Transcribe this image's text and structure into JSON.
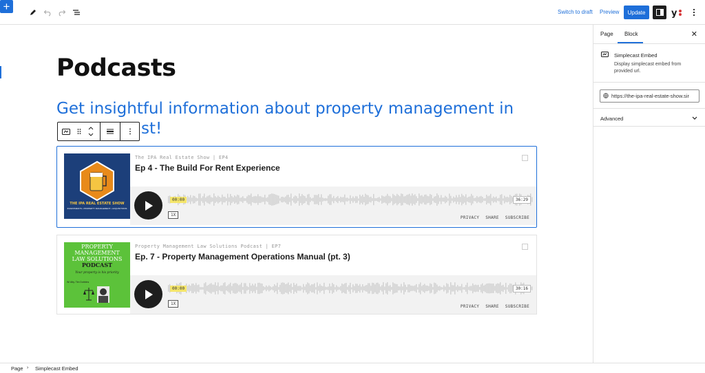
{
  "toolbar": {
    "switch_to_draft": "Switch to draft",
    "preview": "Preview",
    "update": "Update"
  },
  "content": {
    "title": "Podcasts",
    "subtitle": "Get insightful information about property management in",
    "subtitle_tail": "st!"
  },
  "embeds": [
    {
      "show_line": "The IPA Real Estate Show | EP4",
      "title": "Ep 4 - The Build For Rent Experience",
      "cover_text_top": "THE IPA REAL ESTATE SHOW",
      "cover_text_bottom": "INVESTMENTS • PROPERTY MANAGEMENT • ACQUISITIONS",
      "time_start": "00:00",
      "time_end": "36:29",
      "speed": "1X",
      "links": [
        "PRIVACY",
        "SHARE",
        "SUBSCRIBE"
      ]
    },
    {
      "show_line": "Property Management Law Solutions Podcast | EP7",
      "title": "Ep. 7 - Property Management Operations Manual (pt. 3)",
      "cover_lines": [
        "PROPERTY",
        "MANAGEMENT",
        "LAW SOLUTIONS",
        "PODCAST"
      ],
      "cover_tagline": "Your property is his priority",
      "cover_host": "W/ Atty. Tim Dobbins",
      "time_start": "00:00",
      "time_end": "30:16",
      "speed": "1X",
      "links": [
        "PRIVACY",
        "SHARE",
        "SUBSCRIBE"
      ]
    }
  ],
  "sidebar": {
    "tab_page": "Page",
    "tab_block": "Block",
    "block_name": "Simplecast Embed",
    "block_desc": "Display simplecast embed from provided url.",
    "url_value": "https://the-ipa-real-estate-show.sir",
    "advanced": "Advanced"
  },
  "statusbar": {
    "crumb_page": "Page",
    "crumb_block": "Simplecast Embed"
  },
  "colors": {
    "accent": "#1e6fd9",
    "cover1_bg": "#1c3f7a",
    "cover2_bg": "#5cc23a"
  }
}
